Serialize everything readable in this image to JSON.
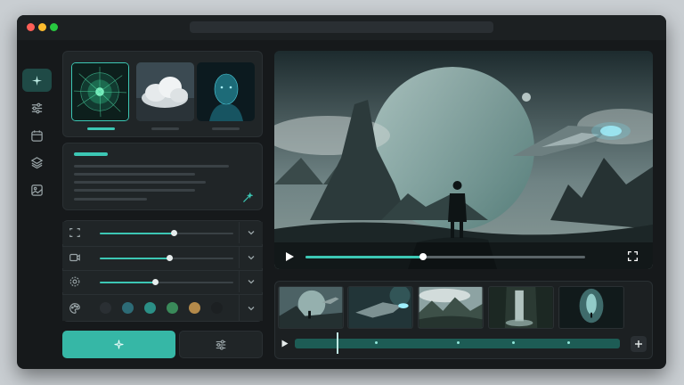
{
  "window": {
    "traffic_lights": [
      "#ff5f57",
      "#febc2e",
      "#28c840"
    ]
  },
  "sidebar": {
    "items": [
      {
        "icon": "sparkle-icon",
        "active": true
      },
      {
        "icon": "sliders-icon",
        "active": false
      },
      {
        "icon": "calendar-icon",
        "active": false
      },
      {
        "icon": "layers-icon",
        "active": false
      },
      {
        "icon": "gallery-icon",
        "active": false
      }
    ]
  },
  "style_presets": [
    {
      "name": "network-sphere",
      "selected": true
    },
    {
      "name": "clouds",
      "selected": false
    },
    {
      "name": "digital-face",
      "selected": false
    }
  ],
  "prompt": {
    "magic_icon": "magic-wand-icon"
  },
  "settings": [
    {
      "icon": "aspect-ratio-icon",
      "level": 0.55
    },
    {
      "icon": "video-camera-icon",
      "level": 0.52
    },
    {
      "icon": "motion-icon",
      "level": 0.41
    },
    {
      "icon": "palette-icon",
      "swatches": [
        "#2a2f33",
        "#2d6b76",
        "#2b8f86",
        "#3a8a5a",
        "#b48a4a",
        "#1c2022"
      ]
    }
  ],
  "actions": {
    "generate_icon": "sparkle-icon",
    "adjust_icon": "sliders-icon"
  },
  "player": {
    "progress": 0.42,
    "play_icon": "play-icon",
    "fullscreen_icon": "fullscreen-icon"
  },
  "timeline": {
    "clips": [
      "planet-warrior",
      "spaceship",
      "mountain-valley",
      "waterfall-forest",
      "cave-light"
    ],
    "playhead": 0.13,
    "markers": [
      0.25,
      0.5,
      0.67,
      0.84
    ],
    "play_icon": "play-icon",
    "add_icon": "plus-icon"
  },
  "colors": {
    "accent": "#36b7a6",
    "background": "#16191b",
    "panel": "#202527"
  }
}
